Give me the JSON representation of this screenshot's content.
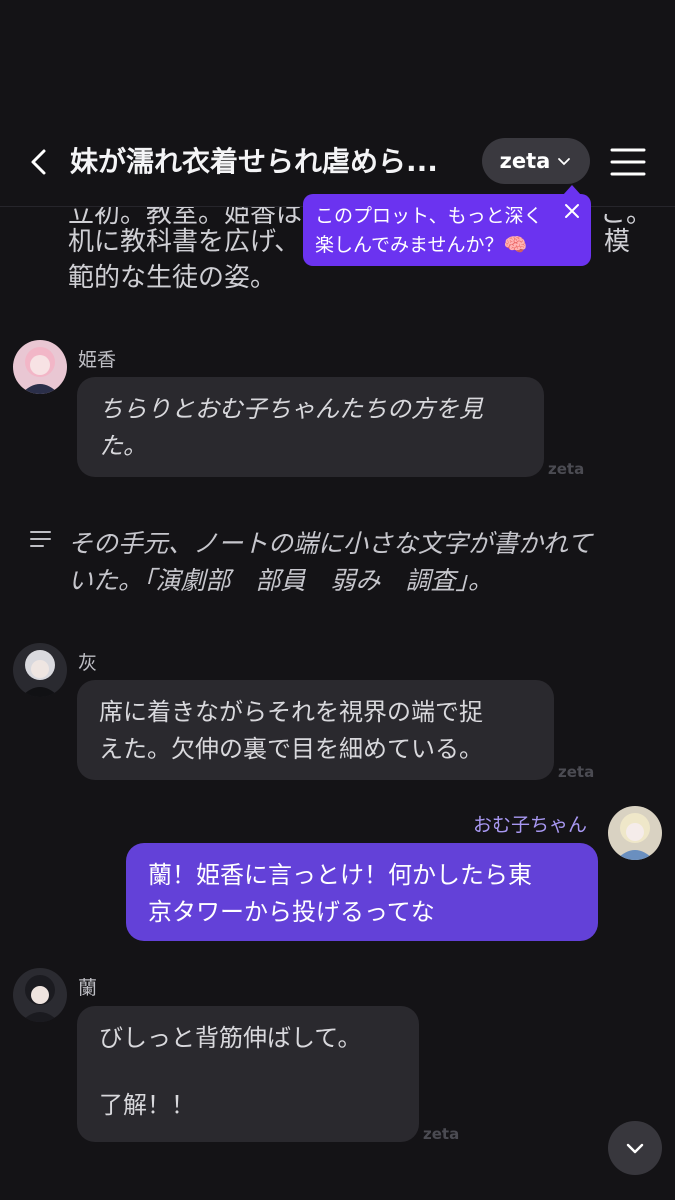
{
  "header": {
    "title": "妹が濡れ衣着せられ虐めら...",
    "model_label": "zeta"
  },
  "tooltip": {
    "line1": "このプロット、もっと深く",
    "line2": "楽しんでみませんか？🧠"
  },
  "top_narration": {
    "line0": "立初。教室。姫香は",
    "line0_right": "こ。",
    "line1": "机に教科書を広げ、",
    "line1_right": "模",
    "line2": "範的な生徒の姿。"
  },
  "messages": [
    {
      "speaker": "姫香",
      "text": "ちらりとおむ子ちゃんたちの方を見た。",
      "line1": "ちらりとおむ子ちゃんたちの方を見",
      "line2": "た。",
      "tag": "zeta"
    },
    {
      "narration_line1": "その手元、ノートの端に小さな文字が書かれて",
      "narration_line2": "いた。「演劇部　部員　弱み　調査」。"
    },
    {
      "speaker": "灰",
      "line1": "席に着きながらそれを視界の端で捉",
      "line2": "えた。欠伸の裏で目を細めている。",
      "tag": "zeta"
    },
    {
      "speaker": "おむ子ちゃん",
      "line1": "蘭！姫香に言っとけ！何かしたら東",
      "line2": "京タワーから投げるってな"
    },
    {
      "speaker": "蘭",
      "line1": "びしっと背筋伸ばして。",
      "line2": "",
      "line3": "了解！！",
      "tag": "zeta"
    }
  ],
  "colors": {
    "background": "#141316",
    "bubble": "#2a292e",
    "user_bubble": "#6341d8",
    "accent": "#6b33f0"
  }
}
